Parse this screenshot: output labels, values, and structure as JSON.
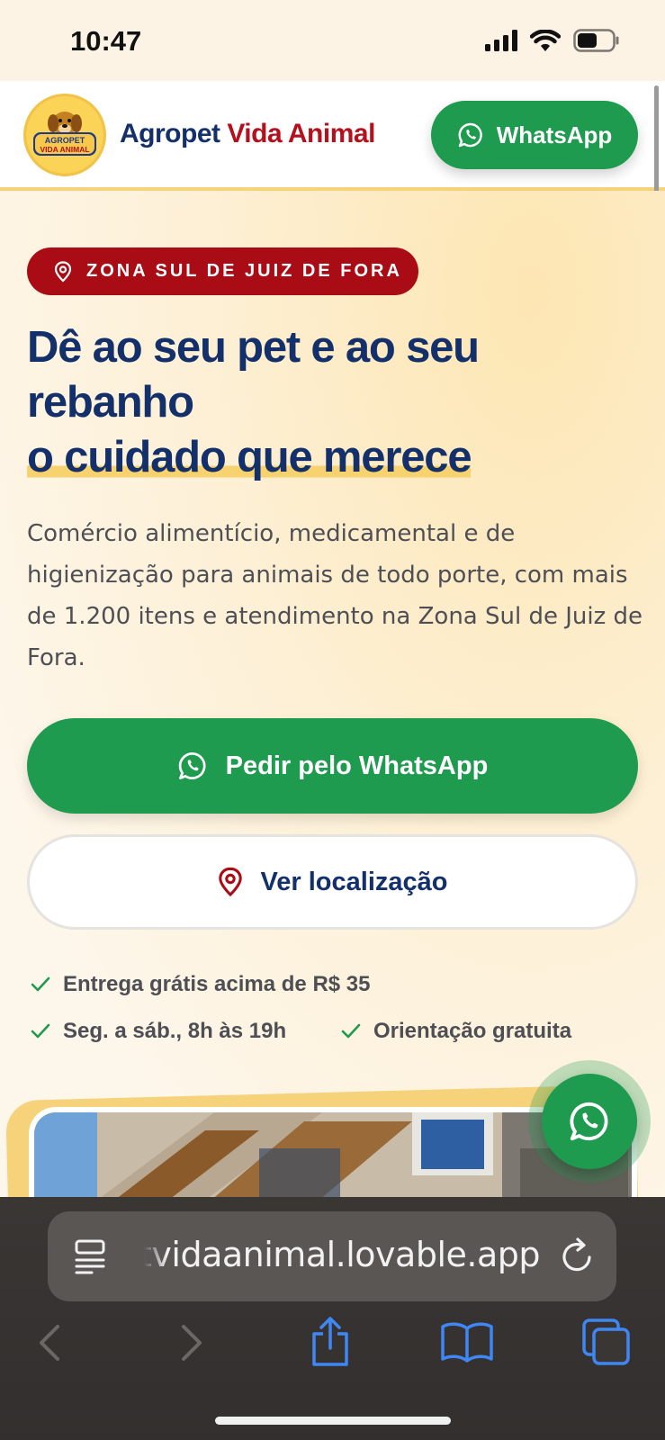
{
  "status_bar": {
    "time": "10:47"
  },
  "header": {
    "brand_part1": "Agropet",
    "brand_part2": "Vida Animal",
    "whatsapp_label": "WhatsApp",
    "logo_text_top": "AGROPET",
    "logo_text_bottom": "VIDA ANIMAL"
  },
  "hero": {
    "badge": "ZONA SUL DE JUIZ DE FORA",
    "title_line1": "Dê ao seu pet e ao seu",
    "title_line2": "rebanho",
    "title_line3": "o cuidado que merece",
    "description": "Comércio alimentício, medicamental e de higienização para animais de todo porte, com mais de 1.200 itens e atendimento na Zona Sul de Juiz de Fora.",
    "primary_button": "Pedir pelo WhatsApp",
    "secondary_button": "Ver localização",
    "features": [
      "Entrega grátis acima de R$ 35",
      "Seg. a sáb., 8h às 19h",
      "Orientação gratuita"
    ]
  },
  "browser": {
    "url": "agropetvidaanimal.lovable.app"
  },
  "colors": {
    "navy": "#14306b",
    "red": "#b3111c",
    "green": "#1e9b4e",
    "yellow_highlight": "#f7d26e"
  }
}
